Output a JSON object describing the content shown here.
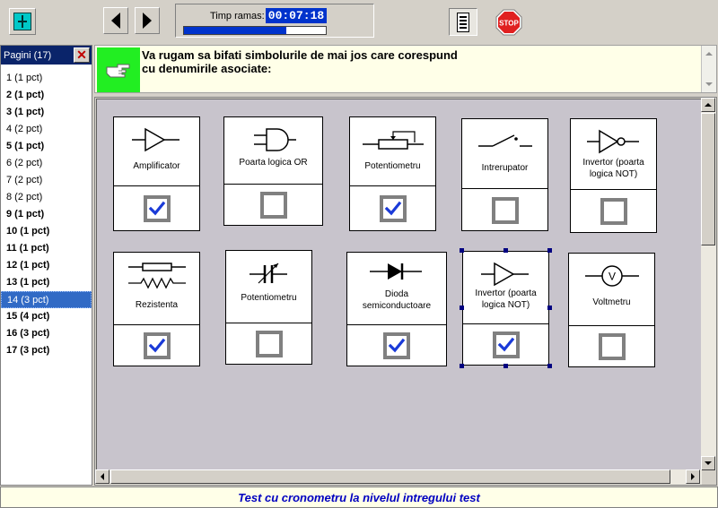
{
  "toolbar": {
    "layout_icon": "split-layout-icon",
    "prev_icon": "arrow-left-icon",
    "next_icon": "arrow-right-icon",
    "timer": {
      "label": "Timp ramas:",
      "value": "00:07:18",
      "progress": 0.72
    },
    "list_icon": "list-icon",
    "stop_label": "STOP",
    "stop_color": "#e02020"
  },
  "sidebar": {
    "title": "Pagini (17)",
    "close_icon": "close-icon",
    "items": [
      {
        "label": "1 (1 pct)",
        "bold": false,
        "selected": false
      },
      {
        "label": "2 (1 pct)",
        "bold": true,
        "selected": false
      },
      {
        "label": "3 (1 pct)",
        "bold": true,
        "selected": false
      },
      {
        "label": "4 (2 pct)",
        "bold": false,
        "selected": false
      },
      {
        "label": "5 (1 pct)",
        "bold": true,
        "selected": false
      },
      {
        "label": "6 (2 pct)",
        "bold": false,
        "selected": false
      },
      {
        "label": "7 (2 pct)",
        "bold": false,
        "selected": false
      },
      {
        "label": "8 (2 pct)",
        "bold": false,
        "selected": false
      },
      {
        "label": "9 (1 pct)",
        "bold": true,
        "selected": false
      },
      {
        "label": "10 (1 pct)",
        "bold": true,
        "selected": false
      },
      {
        "label": "11 (1 pct)",
        "bold": true,
        "selected": false
      },
      {
        "label": "12 (1 pct)",
        "bold": true,
        "selected": false
      },
      {
        "label": "13 (1 pct)",
        "bold": true,
        "selected": false
      },
      {
        "label": "14 (3 pct)",
        "bold": false,
        "selected": true
      },
      {
        "label": "15 (4 pct)",
        "bold": true,
        "selected": false
      },
      {
        "label": "16 (3 pct)",
        "bold": true,
        "selected": false
      },
      {
        "label": "17 (3 pct)",
        "bold": true,
        "selected": false
      }
    ]
  },
  "instruction": {
    "icon": "pointing-hand-icon",
    "icon_bg": "#22ee22",
    "line1": "Va rugam sa bifati simbolurile de mai jos care corespund",
    "line2": "cu denumirile asociate:"
  },
  "cards": [
    {
      "label": "Amplificator",
      "symbol": "amplifier-symbol-icon",
      "checked": true
    },
    {
      "label": "Poarta logica OR",
      "symbol": "or-gate-symbol-icon",
      "checked": false
    },
    {
      "label": "Potentiometru",
      "symbol": "potentiometer-symbol-icon",
      "checked": true
    },
    {
      "label": "Intrerupator",
      "symbol": "switch-symbol-icon",
      "checked": false
    },
    {
      "label": "Invertor (poarta logica NOT)",
      "symbol": "not-gate-symbol-icon",
      "checked": false
    },
    {
      "label": "Rezistenta",
      "symbol": "resistor-symbol-icon",
      "checked": true
    },
    {
      "label": "Potentiometru",
      "symbol": "variable-capacitor-symbol-icon",
      "checked": false
    },
    {
      "label": "Dioda semiconductoare",
      "symbol": "diode-symbol-icon",
      "checked": true
    },
    {
      "label": "Invertor (poarta logica NOT)",
      "symbol": "amplifier-symbol-icon",
      "checked": true
    },
    {
      "label": "Voltmetru",
      "symbol": "voltmeter-symbol-icon",
      "checked": false
    }
  ],
  "status": {
    "text": "Test cu cronometru la nivelul intregului test"
  }
}
